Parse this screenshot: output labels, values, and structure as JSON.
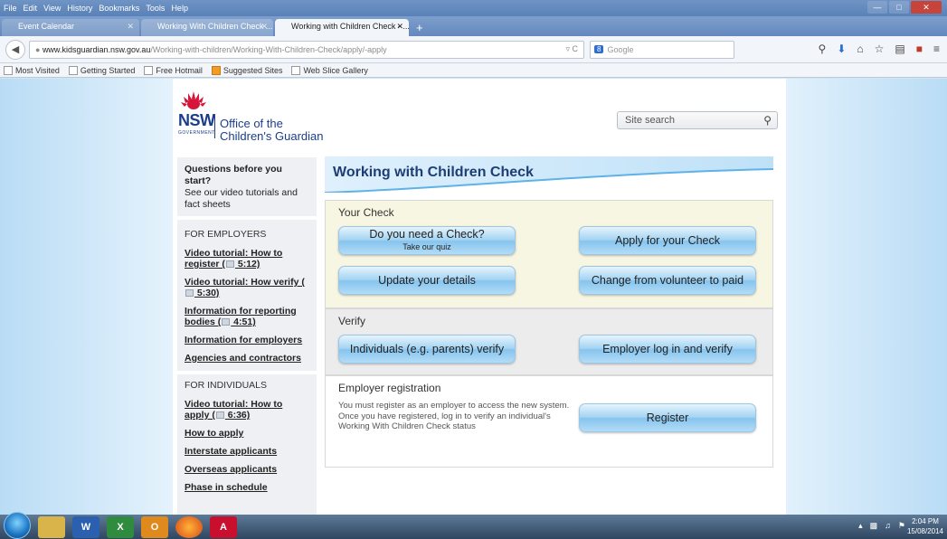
{
  "browser": {
    "menu": [
      "File",
      "Edit",
      "View",
      "History",
      "Bookmarks",
      "Tools",
      "Help"
    ],
    "tabs": [
      {
        "label": "Event Calendar"
      },
      {
        "label": "Working With Children Check ..."
      },
      {
        "label": "Working with Children Check - ..."
      }
    ],
    "url_domain": "www.kidsguardian.nsw.gov.au",
    "url_path": "/Working-with-children/Working-With-Children-Check/apply/-apply",
    "search_placeholder": "Google",
    "bookmarks": [
      "Most Visited",
      "Getting Started",
      "Free Hotmail",
      "Suggested Sites",
      "Web Slice Gallery"
    ]
  },
  "header": {
    "logo_nsw": "NSW",
    "logo_govt": "GOVERNMENT",
    "org_line1": "Office of the",
    "org_line2": "Children's Guardian",
    "site_search_placeholder": "Site search"
  },
  "sidebar": {
    "question_title": "Questions before you start?",
    "question_text": "See our video tutorials and fact sheets",
    "employers_heading": "FOR EMPLOYERS",
    "employer_links": [
      {
        "text": "Video tutorial: How to register (",
        "time": " 5:12)"
      },
      {
        "text": "Video tutorial: How verify (",
        "time": " 5:30)"
      },
      {
        "text": "Information for reporting bodies (",
        "time": " 4:51)"
      },
      {
        "text": "Information for employers"
      },
      {
        "text": "Agencies and contractors"
      }
    ],
    "individuals_heading": "FOR INDIVIDUALS",
    "individual_links": [
      {
        "text": "Video tutorial: How to apply (",
        "time": " 6:36)"
      },
      {
        "text": "How to apply"
      },
      {
        "text": "Interstate applicants"
      },
      {
        "text": "Overseas applicants"
      },
      {
        "text": "Phase in schedule"
      }
    ]
  },
  "main": {
    "title": "Working with Children Check",
    "your_check": {
      "title": "Your Check",
      "need_check": "Do you need a Check?",
      "need_check_sub": "Take our quiz",
      "apply": "Apply for your Check",
      "update": "Update your details",
      "change": "Change from volunteer to paid"
    },
    "verify": {
      "title": "Verify",
      "individuals": "Individuals (e.g. parents) verify",
      "employer": "Employer log in and verify"
    },
    "registration": {
      "title": "Employer registration",
      "desc_1": "You must register as an employer to access the new system.",
      "desc_2": "Once you have registered, log in to verify an individual's",
      "desc_3": "Working With Children Check status",
      "register": "Register"
    }
  },
  "taskbar": {
    "word": "W",
    "excel": "X",
    "outlook": "O",
    "acrobat": "A",
    "time": "2:04 PM",
    "date": "15/08/2014"
  },
  "colors": {
    "brand_blue": "#1b3e8a",
    "title_blue": "#1d3d75",
    "banner_blue": "#cfe8fa",
    "button_blue": "#a3d3f2",
    "check_panel_bg": "#f7f6e2",
    "verify_panel_bg": "#ececec"
  }
}
